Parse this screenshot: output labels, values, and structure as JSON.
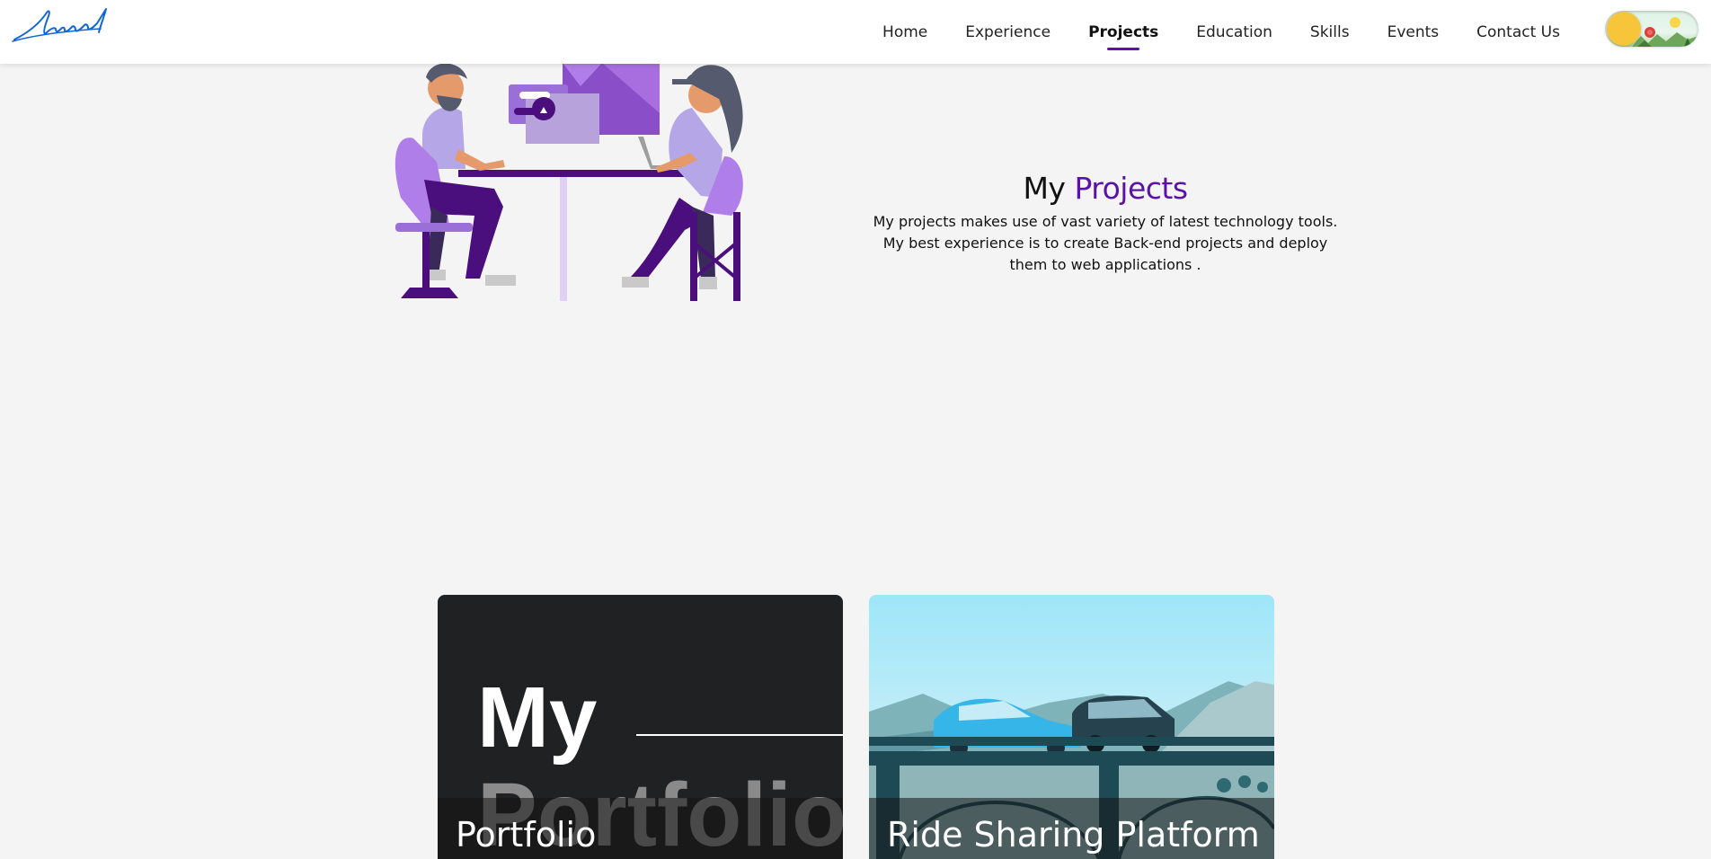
{
  "nav": {
    "logo_icon": "signature-logo-icon",
    "items": [
      {
        "label": "Home",
        "active": false
      },
      {
        "label": "Experience",
        "active": false
      },
      {
        "label": "Projects",
        "active": true
      },
      {
        "label": "Education",
        "active": false
      },
      {
        "label": "Skills",
        "active": false
      },
      {
        "label": "Events",
        "active": false
      },
      {
        "label": "Contact Us",
        "active": false
      }
    ],
    "theme_toggle_icon": "sun-landscape-toggle-icon"
  },
  "hero": {
    "illustration_icon": "people-working-at-desk-illustration",
    "title_prefix": "My",
    "title_accent": "Projects",
    "description": "My projects makes use of vast variety of latest technology tools. My best experience is to create Back-end projects and deploy them to web applications ."
  },
  "projects": [
    {
      "title": "Portfolio",
      "art_line1": "My",
      "art_line2": "Portfolio"
    },
    {
      "title": "Ride Sharing Platform",
      "art_icon": "cars-on-bridge-illustration"
    }
  ],
  "colors": {
    "accent": "#5b12a8",
    "background": "#f4f4f4",
    "logo_blue": "#1366d6"
  }
}
